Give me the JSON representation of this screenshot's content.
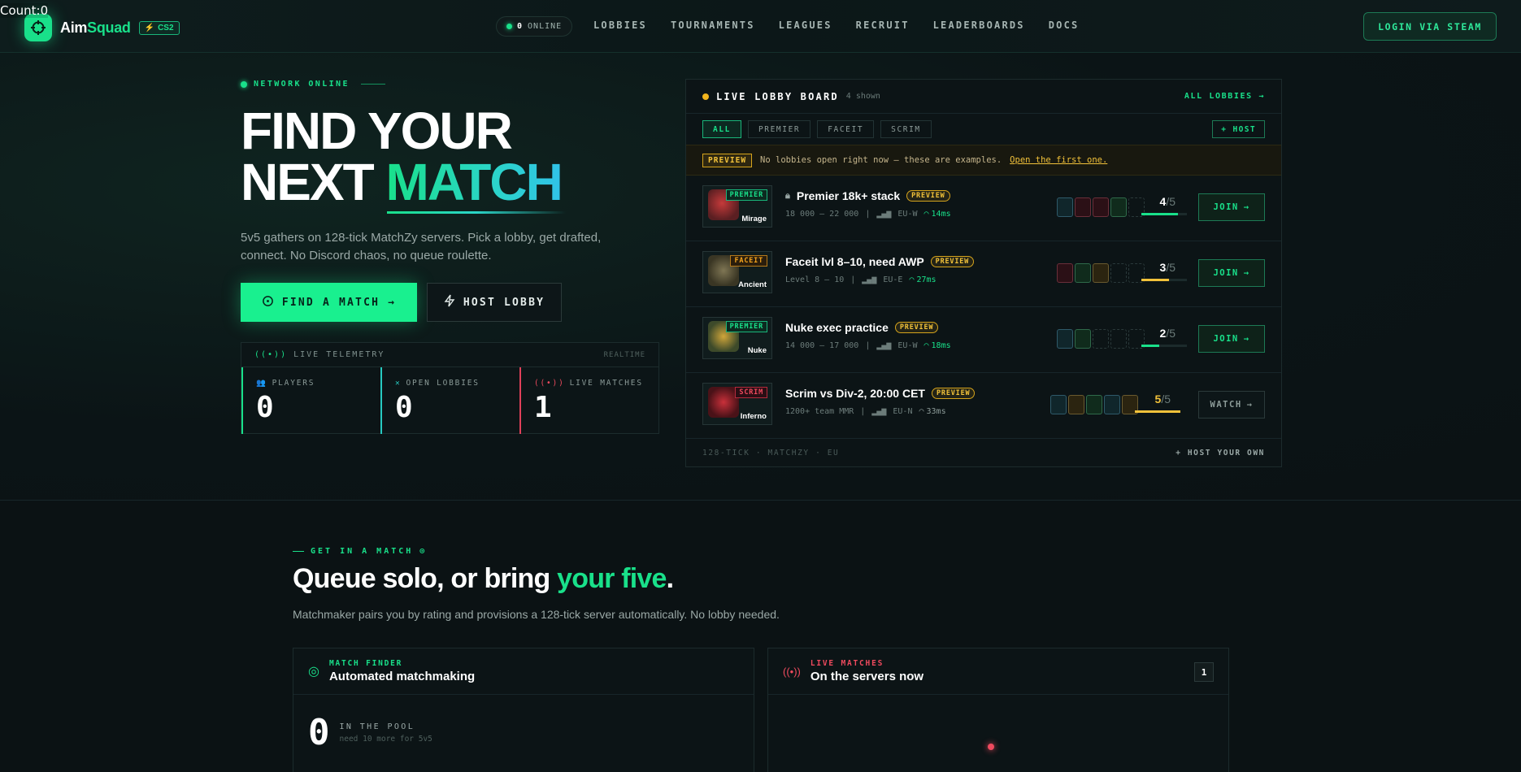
{
  "overlay": {
    "count": "Count:0"
  },
  "brand": {
    "name_a": "Aim",
    "name_b": "Squad",
    "badge": "CS2"
  },
  "header": {
    "online_count": "0",
    "online_label": "ONLINE",
    "nav": [
      "LOBBIES",
      "TOURNAMENTS",
      "LEAGUES",
      "RECRUIT",
      "LEADERBOARDS",
      "DOCS"
    ],
    "login": "LOGIN VIA STEAM"
  },
  "hero": {
    "eyebrow": "NETWORK ONLINE",
    "title_line1": "FIND YOUR",
    "title_line2_a": "NEXT ",
    "title_line2_b": "MATCH",
    "subtitle": "5v5 gathers on 128-tick MatchZy servers. Pick a lobby, get drafted, connect. No Discord chaos, no queue roulette.",
    "cta_primary": "FIND A MATCH",
    "cta_secondary": "HOST LOBBY"
  },
  "telemetry": {
    "title": "LIVE TELEMETRY",
    "mode": "REALTIME",
    "stats": [
      {
        "label": "PLAYERS",
        "value": "0"
      },
      {
        "label": "OPEN LOBBIES",
        "value": "0"
      },
      {
        "label": "LIVE MATCHES",
        "value": "1"
      }
    ]
  },
  "board": {
    "title": "LIVE LOBBY BOARD",
    "shown": "4 shown",
    "all_link": "ALL LOBBIES",
    "filters": [
      "ALL",
      "PREMIER",
      "FACEIT",
      "SCRIM"
    ],
    "host": "+ HOST",
    "preview_tag": "PREVIEW",
    "preview_text": "No lobbies open right now — these are examples.",
    "preview_link": "Open the first one.",
    "lobbies": [
      {
        "tag": "PREMIER",
        "map": "Mirage",
        "title": "Premier 18k+ stack",
        "pill": "PREVIEW",
        "meta": "18 000 – 22 000",
        "region": "EU-W",
        "ping": "14ms",
        "filled": "4",
        "max": "/5",
        "fill_fraction": 0.8,
        "action": "JOIN"
      },
      {
        "tag": "FACEIT",
        "map": "Ancient",
        "title": "Faceit lvl 8–10, need AWP",
        "pill": "PREVIEW",
        "meta": "Level 8 – 10",
        "region": "EU-E",
        "ping": "27ms",
        "filled": "3",
        "max": "/5",
        "fill_fraction": 0.6,
        "action": "JOIN"
      },
      {
        "tag": "PREMIER",
        "map": "Nuke",
        "title": "Nuke exec practice",
        "pill": "PREVIEW",
        "meta": "14 000 – 17 000",
        "region": "EU-W",
        "ping": "18ms",
        "filled": "2",
        "max": "/5",
        "fill_fraction": 0.4,
        "action": "JOIN"
      },
      {
        "tag": "SCRIM",
        "map": "Inferno",
        "title": "Scrim vs Div-2, 20:00 CET",
        "pill": "PREVIEW",
        "meta": "1200+ team MMR",
        "region": "EU-N",
        "ping": "33ms",
        "filled": "5",
        "max": "/5",
        "fill_fraction": 1.0,
        "action": "WATCH"
      }
    ],
    "footer_left": "128-TICK · MATCHZY · EU",
    "footer_right": "+ HOST YOUR OWN"
  },
  "section2": {
    "eyebrow": "GET IN A MATCH",
    "title_a": "Queue solo, or bring ",
    "title_b": "your five",
    "title_c": ".",
    "subtitle": "Matchmaker pairs you by rating and provisions a 128-tick server automatically. No lobby needed.",
    "finder": {
      "kicker": "MATCH FINDER",
      "heading": "Automated matchmaking",
      "pool_value": "0",
      "pool_label": "IN THE POOL",
      "pool_hint": "need 10 more for 5v5"
    },
    "live": {
      "kicker": "LIVE MATCHES",
      "heading": "On the servers now",
      "count": "1"
    }
  },
  "colors": {
    "accent": "#19e08a",
    "warning": "#f2c23a",
    "danger": "#ef4a5e",
    "bg": "#0b1214"
  }
}
